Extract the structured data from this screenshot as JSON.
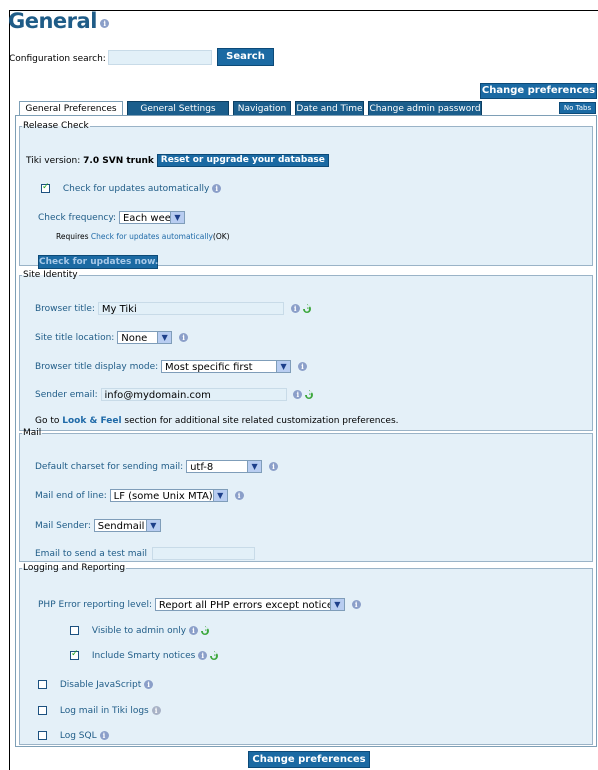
{
  "page": {
    "title": "General",
    "search_label": "Configuration search:",
    "search_value": "",
    "search_button": "Search",
    "change_prefs": "Change preferences"
  },
  "tabs": [
    {
      "label": "General Preferences",
      "active": true
    },
    {
      "label": "General Settings",
      "active": false
    },
    {
      "label": "Navigation",
      "active": false
    },
    {
      "label": "Date and Time",
      "active": false
    },
    {
      "label": "Change admin password",
      "active": false
    }
  ],
  "no_tabs": "No Tabs",
  "release": {
    "legend": "Release Check",
    "tiki_version_label": "Tiki version:",
    "tiki_version": "7.0 SVN trunk",
    "reset_button": "Reset or upgrade your database",
    "check_auto_label": "Check for updates automatically",
    "check_auto_checked": true,
    "freq_label": "Check frequency:",
    "freq_value": "Each week",
    "requires_text": "Requires",
    "requires_link": "Check for updates automatically",
    "requires_status": "(OK)",
    "check_now_button": "Check for updates now."
  },
  "site_identity": {
    "legend": "Site Identity",
    "browser_title_label": "Browser title:",
    "browser_title_value": "My Tiki",
    "site_title_location_label": "Site title location:",
    "site_title_location_value": "None",
    "display_mode_label": "Browser title display mode:",
    "display_mode_value": "Most specific first",
    "sender_email_label": "Sender email:",
    "sender_email_value": "info@mydomain.com",
    "goto_prefix": "Go to",
    "goto_link": "Look & Feel",
    "goto_suffix": "section for additional site related customization preferences."
  },
  "mail": {
    "legend": "Mail",
    "charset_label": "Default charset for sending mail:",
    "charset_value": "utf-8",
    "eol_label": "Mail end of line:",
    "eol_value": "LF (some Unix MTA)",
    "sender_label": "Mail Sender:",
    "sender_value": "Sendmail",
    "test_label": "Email to send a test mail",
    "test_value": ""
  },
  "logging": {
    "legend": "Logging and Reporting",
    "php_error_label": "PHP Error reporting level:",
    "php_error_value": "Report all PHP errors except notices",
    "visible_admin_label": "Visible to admin only",
    "visible_admin_checked": false,
    "smarty_label": "Include Smarty notices",
    "smarty_checked": true,
    "disable_js_label": "Disable JavaScript",
    "disable_js_checked": false,
    "log_mail_label": "Log mail in Tiki logs",
    "log_mail_checked": false,
    "log_sql_label": "Log SQL",
    "log_sql_checked": false
  },
  "colors": {
    "title": "#1f5c87",
    "button": "#1b6aa3",
    "fieldset_bg": "#e4f0f8",
    "label": "#1f5c87"
  }
}
